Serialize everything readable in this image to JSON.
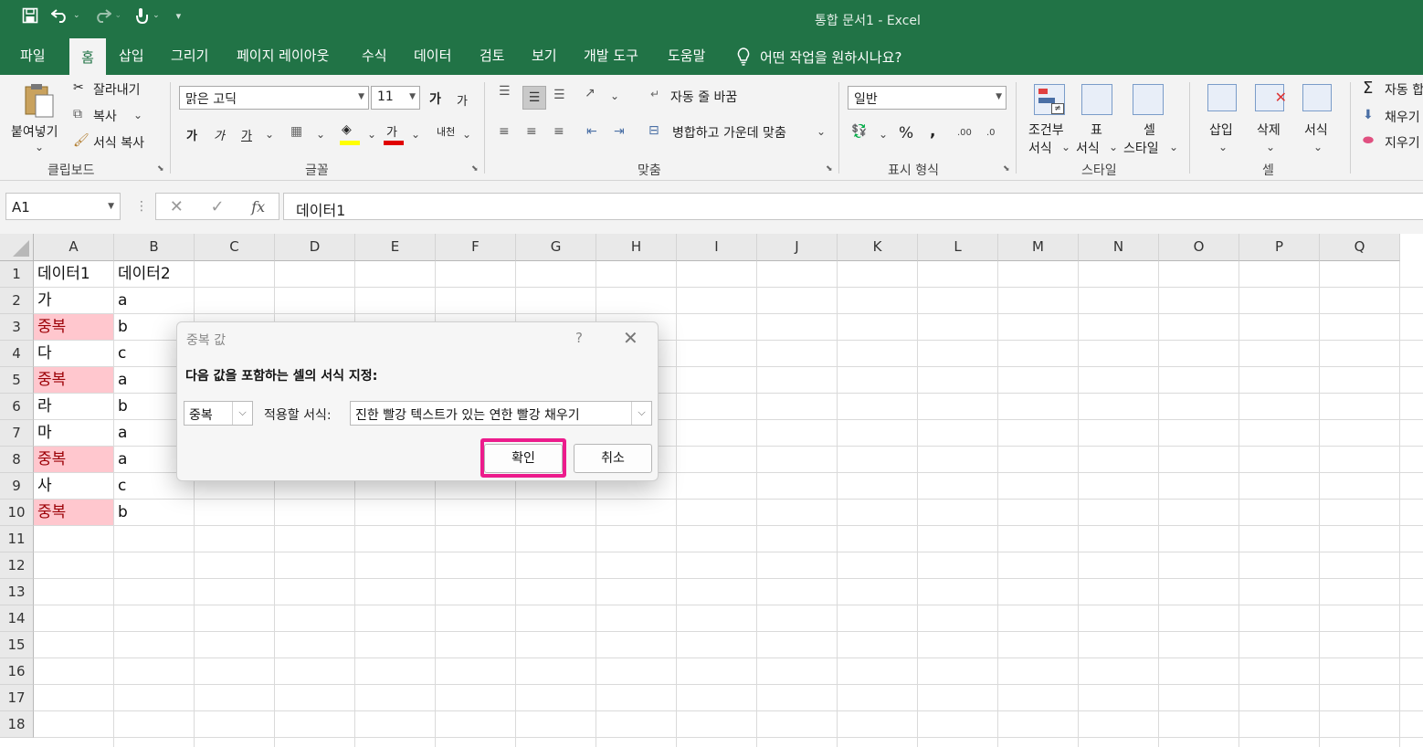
{
  "window": {
    "title": "통합 문서1  -  Excel"
  },
  "qat": {
    "save_icon": "save-icon",
    "undo_icon": "undo-icon",
    "redo_icon": "redo-icon",
    "touch_icon": "touch-mode-icon"
  },
  "menu": {
    "tabs": [
      "파일",
      "홈",
      "삽입",
      "그리기",
      "페이지 레이아웃",
      "수식",
      "데이터",
      "검토",
      "보기",
      "개발 도구",
      "도움말"
    ],
    "active": "홈",
    "tell_me": "어떤 작업을 원하시나요?"
  },
  "ribbon": {
    "clipboard": {
      "paste": "붙여넣기",
      "cut": "잘라내기",
      "copy": "복사",
      "format_painter": "서식 복사",
      "label": "클립보드"
    },
    "font": {
      "name": "맑은 고딕",
      "size": "11",
      "grow": "가",
      "shrink": "가",
      "bold": "가",
      "italic": "가",
      "underline": "가",
      "color_letter": "가",
      "phonetic": "내천",
      "label": "글꼴"
    },
    "alignment": {
      "wrap": "자동 줄 바꿈",
      "merge": "병합하고 가운데 맞춤",
      "label": "맞춤"
    },
    "number": {
      "format": "일반",
      "percent": "%",
      "comma": ",",
      "inc": ".00",
      "dec": ".0",
      "label": "표시 형식"
    },
    "styles": {
      "conditional_1": "조건부",
      "conditional_2": "서식",
      "table_1": "표",
      "table_2": "서식",
      "cell_1": "셀",
      "cell_2": "스타일",
      "label": "스타일"
    },
    "cells": {
      "insert": "삽입",
      "delete": "삭제",
      "format": "서식",
      "label": "셀"
    },
    "editing": {
      "autosum": "자동 합",
      "fill": "채우기",
      "clear": "지우기"
    }
  },
  "formula_bar": {
    "name_box": "A1",
    "cancel": "✕",
    "enter": "✓",
    "fx": "fx",
    "value": "데이터1"
  },
  "grid": {
    "columns": [
      "A",
      "B",
      "C",
      "D",
      "E",
      "F",
      "G",
      "H",
      "I",
      "J",
      "K",
      "L",
      "M",
      "N",
      "O",
      "P",
      "Q"
    ],
    "rows": [
      "1",
      "2",
      "3",
      "4",
      "5",
      "6",
      "7",
      "8",
      "9",
      "10",
      "11",
      "12",
      "13",
      "14",
      "15",
      "16",
      "17",
      "18"
    ],
    "col_a": [
      "데이터1",
      "가",
      "중복",
      "다",
      "중복",
      "라",
      "마",
      "중복",
      "사",
      "중복"
    ],
    "col_b": [
      "데이터2",
      "a",
      "b",
      "c",
      "a",
      "b",
      "a",
      "a",
      "c",
      "b"
    ],
    "duplicate_rows": [
      3,
      5,
      8,
      10
    ]
  },
  "dialog": {
    "title": "중복 값",
    "help": "?",
    "prompt": "다음 값을 포함하는 셀의 서식 지정:",
    "rule_value": "중복",
    "apply_label": "적용할 서식:",
    "format_value": "진한 빨강 텍스트가 있는 연한 빨강 채우기",
    "ok": "확인",
    "cancel": "취소"
  },
  "colors": {
    "excel_green": "#217346",
    "dup_fill": "#ffc7ce",
    "dup_text": "#9c0006",
    "highlight": "#ec1c8c"
  }
}
